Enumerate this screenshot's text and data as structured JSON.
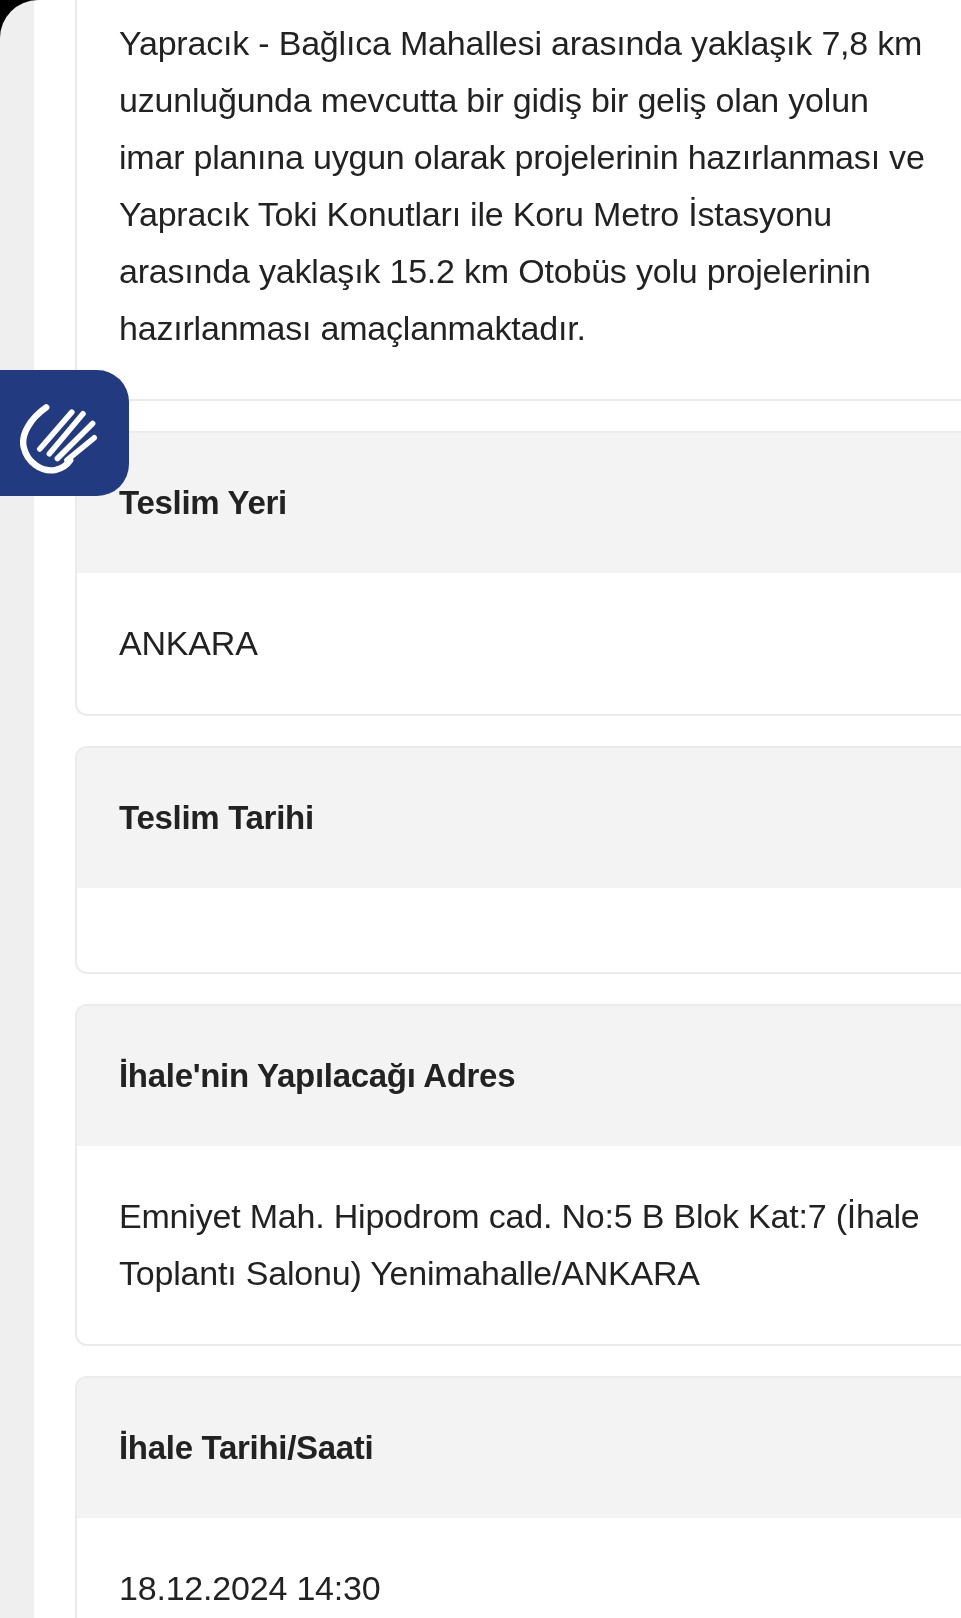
{
  "description_card": {
    "text": "Yapracık - Bağlıca Mahallesi arasında yaklaşık 7,8 km uzunluğunda mevcutta bir gidiş bir geliş olan yolun imar planına uygun olarak projelerinin hazırlanması ve Yapracık Toki Konutları ile Koru Metro İstasyonu arasında yaklaşık 15.2 km Otobüs yolu projelerinin hazırlanması amaçlanmaktadır."
  },
  "info_cards": [
    {
      "title": "Teslim Yeri",
      "value": "ANKARA"
    },
    {
      "title": "Teslim Tarihi"
    },
    {
      "title": "İhale'nin Yapılacağı Adres",
      "value": "Emniyet Mah. Hipodrom cad. No:5 B Blok Kat:7 (İhale Toplantı Salonu) Yenimahalle/ANKARA"
    },
    {
      "title": "İhale Tarihi/Saati",
      "value": "18.12.2024 14:30"
    }
  ]
}
